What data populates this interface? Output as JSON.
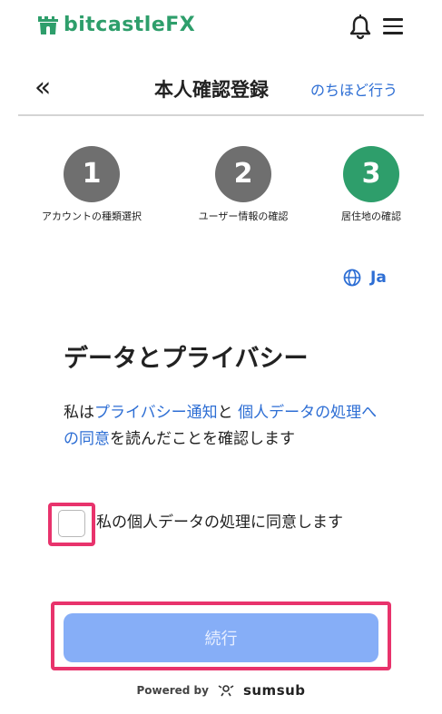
{
  "header": {
    "logo_text": "bitcastleFX",
    "logo_icon": "castle-icon",
    "bell_icon": "bell-icon",
    "menu_icon": "hamburger-menu-icon"
  },
  "titlebar": {
    "back_icon": "double-chevron-left-icon",
    "back_glyph": "«",
    "title": "本人確認登録",
    "later_link": "のちほど行う"
  },
  "steps": [
    {
      "number": "1",
      "label": "アカウントの種類選択",
      "state": "complete",
      "color": "#6f6f6f"
    },
    {
      "number": "2",
      "label": "ユーザー情報の確認",
      "state": "complete",
      "color": "#6f6f6f"
    },
    {
      "number": "3",
      "label": "居住地の確認",
      "state": "active",
      "color": "#2e9e6b"
    }
  ],
  "language": {
    "icon": "globe-icon",
    "code": "Ja"
  },
  "consent": {
    "heading": "データとプライバシー",
    "para_prefix": "私は",
    "privacy_notice_link": "プライバシー通知",
    "para_and": "と ",
    "personal_data_link": "個人データの処理への同意",
    "para_suffix": "を読んだことを確認します",
    "checkbox_label": "私の個人データの処理に同意します",
    "checkbox_checked": false
  },
  "actions": {
    "continue_label": "続行"
  },
  "footer": {
    "powered_by": "Powered by",
    "brand": "sumsub",
    "brand_icon": "sumsub-logo-icon"
  },
  "colors": {
    "brand_green": "#2e9e6b",
    "link_blue": "#2d6ed4",
    "button_disabled": "#86aef7",
    "highlight": "#e8336c",
    "step_inactive": "#6f6f6f"
  }
}
